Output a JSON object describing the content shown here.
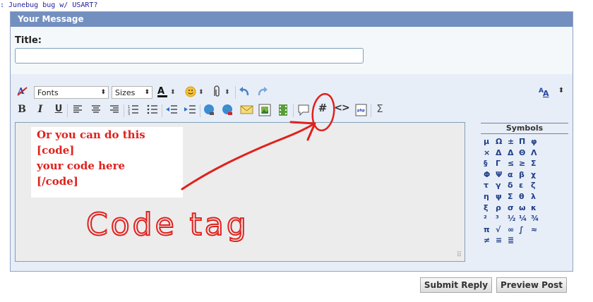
{
  "breadcrumb": ": Junebug bug w/ USART?",
  "panel": {
    "header": "Your Message",
    "title_label": "Title:",
    "title_value": ""
  },
  "toolbar": {
    "font_select": "Fonts",
    "size_select": "Sizes",
    "bold": "B",
    "italic": "I",
    "underline": "U",
    "code_hash": "#",
    "html_tag": "<>",
    "php_label": "php",
    "sigma": "Σ"
  },
  "message": {
    "lines": [
      "Or you can do this",
      "[code]",
      "your code here",
      "[/code]"
    ]
  },
  "annotation": {
    "text": "Code tag",
    "color": "#e0211d"
  },
  "symbols": {
    "title": "Symbols",
    "rows": [
      [
        "μ",
        "Ω",
        "±",
        "Π",
        "φ"
      ],
      [
        "×",
        "Δ",
        "Δ",
        "Θ",
        "Λ"
      ],
      [
        "§",
        "Γ",
        "≤",
        "≥",
        "Σ"
      ],
      [
        "Φ",
        "Ψ",
        "α",
        "β",
        "χ"
      ],
      [
        "τ",
        "γ",
        "δ",
        "ε",
        "ζ"
      ],
      [
        "η",
        "ψ",
        "Σ",
        "θ",
        "λ"
      ],
      [
        "ξ",
        "ρ",
        "σ",
        "ω",
        "κ"
      ],
      [
        "²",
        "³",
        "½",
        "¼",
        "¾"
      ],
      [
        "π",
        "√",
        "∞",
        "∫",
        "≈"
      ],
      [
        "≠",
        "≡",
        "≣",
        "",
        ""
      ]
    ]
  },
  "buttons": {
    "submit": "Submit Reply",
    "preview": "Preview Post"
  }
}
